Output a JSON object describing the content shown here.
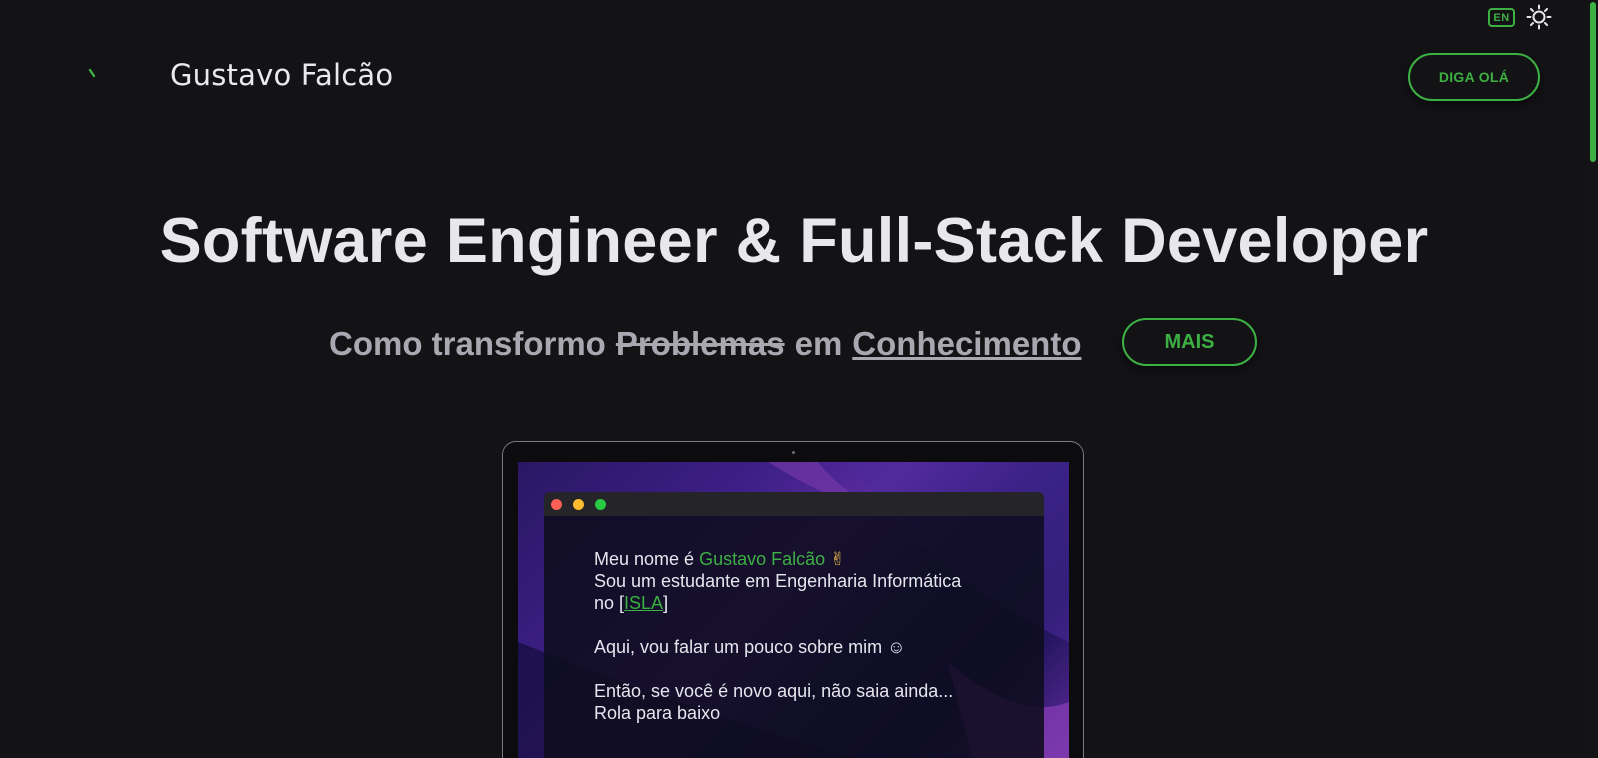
{
  "top_controls": {
    "language": "EN"
  },
  "header": {
    "brand": "Gustavo Falcão",
    "hello_button": "DIGA OLÁ"
  },
  "hero": {
    "title": "Software Engineer & Full-Stack Developer",
    "subtitle_prefix": "Como transformo",
    "subtitle_struck": "Problemas",
    "subtitle_mid": "em",
    "subtitle_underlined": "Conhecimento",
    "more_button": "MAIS"
  },
  "terminal": {
    "line1_prefix": "Meu nome é ",
    "line1_name": "Gustavo Falcão",
    "line1_emoji": "✌",
    "line2": "Sou um estudante em Engenharia Informática",
    "line3_prefix": "no [",
    "line3_link": "ISLA",
    "line3_suffix": "]",
    "line4": "Aqui, vou falar um pouco sobre mim ☺",
    "line5": "Então, se você é novo aqui, não saia ainda...",
    "line6": "Rola para baixo"
  },
  "colors": {
    "accent": "#3cb043",
    "background": "#131316",
    "text": "#e6e6ea",
    "muted": "#a8a8b0"
  },
  "icons": {
    "theme": "sun-icon",
    "logo": "loading-arc-icon",
    "window_controls": [
      "close-dot",
      "minimize-dot",
      "maximize-dot"
    ]
  }
}
